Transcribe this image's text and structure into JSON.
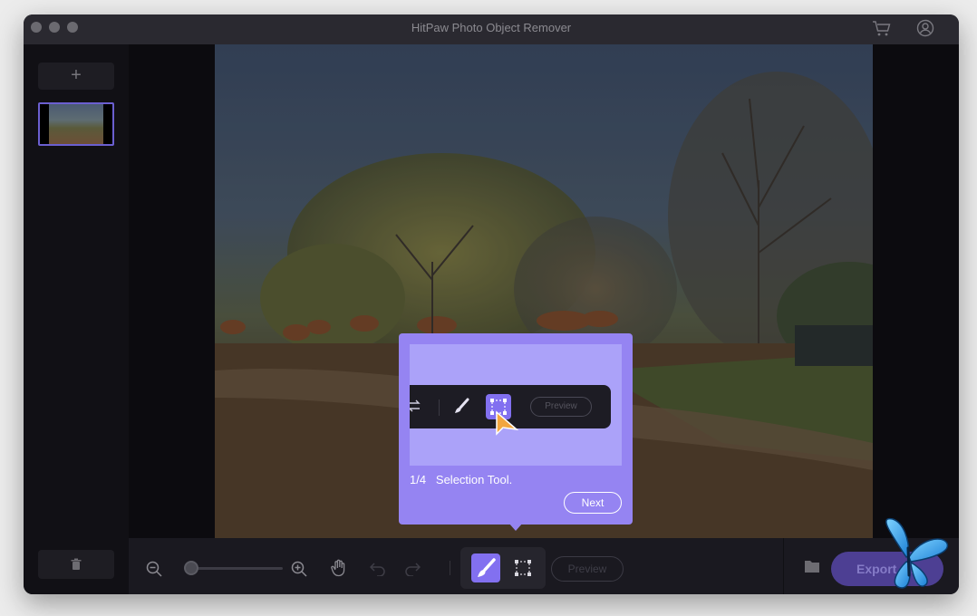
{
  "window": {
    "title": "HitPaw Photo Object Remover",
    "accent_color": "#8270f0"
  },
  "titlebar": {
    "icons": [
      "cart-icon",
      "user-account-icon"
    ]
  },
  "sidebar": {
    "add_label": "+",
    "thumbnails": [
      {
        "selected": true
      }
    ],
    "delete_icon": "trash-icon"
  },
  "tooltip": {
    "step": "1/4",
    "text": "Selection Tool.",
    "step_text": "1/4   Selection Tool.",
    "next_label": "Next",
    "mini_preview_label": "Preview"
  },
  "toolbar": {
    "zoom_out_icon": "zoom-out-icon",
    "zoom_in_icon": "zoom-in-icon",
    "hand_icon": "hand-icon",
    "undo_icon": "undo-icon",
    "redo_icon": "redo-icon",
    "brush_icon": "brush-icon",
    "selection_icon": "rectangle-selection-icon",
    "preview_label": "Preview",
    "folder_icon": "folder-icon",
    "export_label": "Export all"
  }
}
